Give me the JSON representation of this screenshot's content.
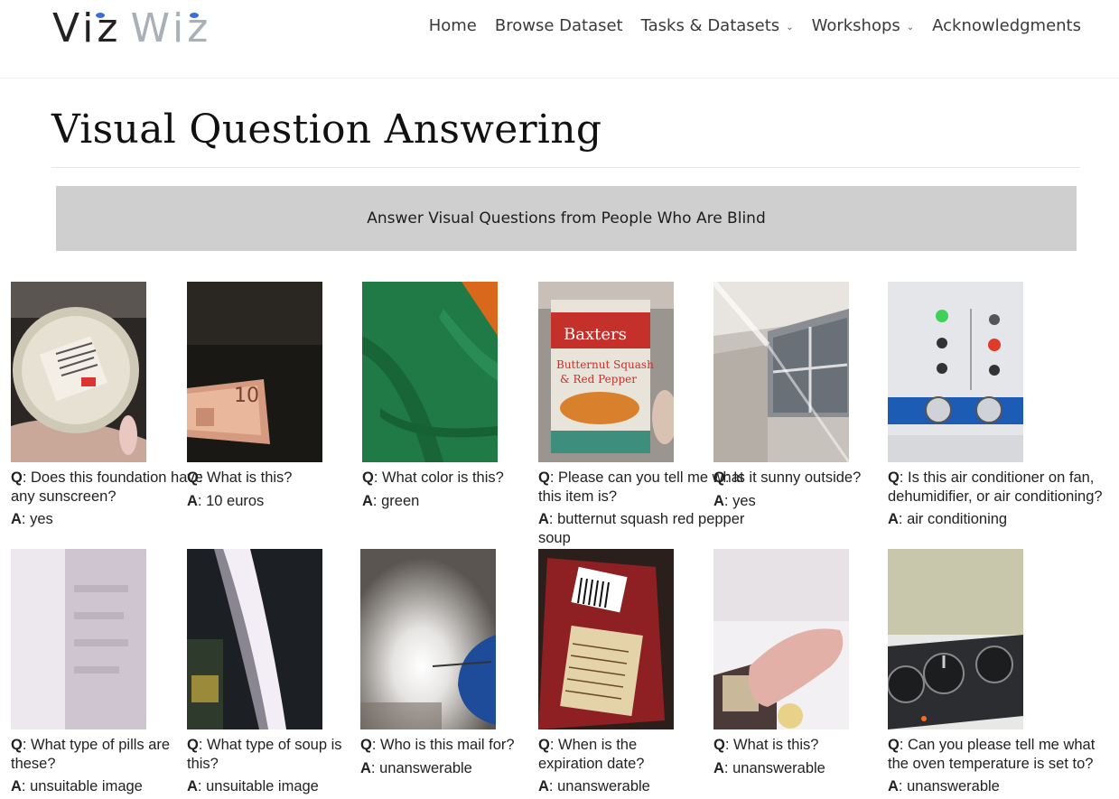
{
  "brand": {
    "logo_part1": "Viz",
    "logo_part2": "Wiz"
  },
  "nav": [
    {
      "label": "Home",
      "dropdown": false
    },
    {
      "label": "Browse Dataset",
      "dropdown": false
    },
    {
      "label": "Tasks & Datasets",
      "dropdown": true
    },
    {
      "label": "Workshops",
      "dropdown": true
    },
    {
      "label": "Acknowledgments",
      "dropdown": false
    }
  ],
  "page": {
    "title": "Visual Question Answering",
    "banner": "Answer Visual Questions from People Who Are Blind"
  },
  "qa_labels": {
    "q": "Q",
    "a": "A"
  },
  "examples": [
    {
      "question": "Does this foundation have any sunscreen?",
      "answer": "yes",
      "image": "foundation-jar"
    },
    {
      "question": "What is this?",
      "answer": "10 euros",
      "image": "euro-banknote"
    },
    {
      "question": "What color is this?",
      "answer": "green",
      "image": "green-fabric"
    },
    {
      "question": "Please can you tell me what this item is?",
      "answer": "butternut squash red pepper soup",
      "image": "soup-can"
    },
    {
      "question": "Is it sunny outside?",
      "answer": "yes",
      "image": "window"
    },
    {
      "question": "Is this air conditioner on fan, dehumidifier, or air conditioning?",
      "answer": "air conditioning",
      "image": "ac-panel"
    },
    {
      "question": "What type of pills are these?",
      "answer": "unsuitable image",
      "image": "blurry-bottle"
    },
    {
      "question": "What type of soup is this?",
      "answer": "unsuitable image",
      "image": "dark-glare"
    },
    {
      "question": "Who is this mail for?",
      "answer": "unanswerable",
      "image": "bright-glare"
    },
    {
      "question": "When is the expiration date?",
      "answer": "unanswerable",
      "image": "food-package"
    },
    {
      "question": "What is this?",
      "answer": "unanswerable",
      "image": "finger"
    },
    {
      "question": "Can you please tell me what the oven temperature is set to?",
      "answer": "unanswerable",
      "image": "oven-knobs"
    }
  ]
}
